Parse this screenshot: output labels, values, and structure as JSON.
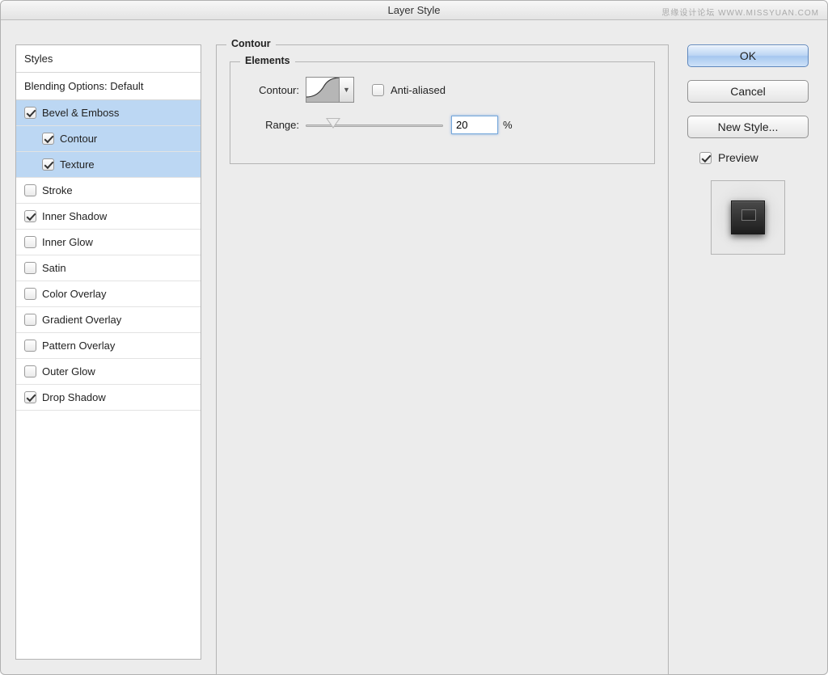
{
  "window": {
    "title": "Layer Style"
  },
  "watermark": "思缘设计论坛  WWW.MISSYUAN.COM",
  "sidebar": {
    "styles_header": "Styles",
    "blending_header": "Blending Options: Default",
    "items": [
      {
        "label": "Bevel & Emboss",
        "checked": true,
        "selected": true,
        "child": false
      },
      {
        "label": "Contour",
        "checked": true,
        "selected": true,
        "child": true
      },
      {
        "label": "Texture",
        "checked": true,
        "selected": true,
        "child": true
      },
      {
        "label": "Stroke",
        "checked": false,
        "selected": false,
        "child": false
      },
      {
        "label": "Inner Shadow",
        "checked": true,
        "selected": false,
        "child": false
      },
      {
        "label": "Inner Glow",
        "checked": false,
        "selected": false,
        "child": false
      },
      {
        "label": "Satin",
        "checked": false,
        "selected": false,
        "child": false
      },
      {
        "label": "Color Overlay",
        "checked": false,
        "selected": false,
        "child": false
      },
      {
        "label": "Gradient Overlay",
        "checked": false,
        "selected": false,
        "child": false
      },
      {
        "label": "Pattern Overlay",
        "checked": false,
        "selected": false,
        "child": false
      },
      {
        "label": "Outer Glow",
        "checked": false,
        "selected": false,
        "child": false
      },
      {
        "label": "Drop Shadow",
        "checked": true,
        "selected": false,
        "child": false
      }
    ]
  },
  "panel": {
    "title": "Contour",
    "elements_title": "Elements",
    "contour_label": "Contour:",
    "anti_aliased_label": "Anti-aliased",
    "anti_aliased_checked": false,
    "range_label": "Range:",
    "range_value": "20",
    "range_unit": "%"
  },
  "buttons": {
    "ok": "OK",
    "cancel": "Cancel",
    "new_style": "New Style...",
    "preview_label": "Preview",
    "preview_checked": true
  }
}
